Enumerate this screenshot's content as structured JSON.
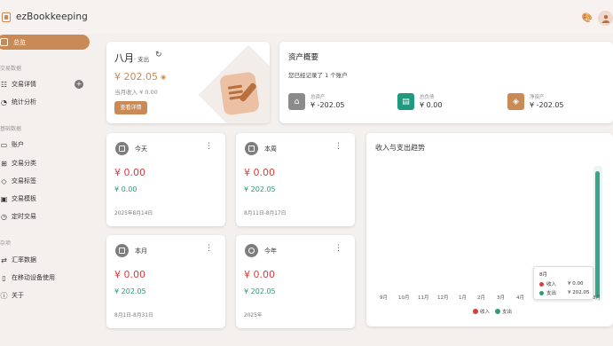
{
  "header": {
    "app_title": "ezBookkeeping"
  },
  "sidebar": {
    "overview_label": "总览",
    "section_transactions": "交易数据",
    "section_basic": "基础数据",
    "section_misc": "杂项",
    "items": [
      {
        "label": "交易详情",
        "icon": "list-icon"
      },
      {
        "label": "统计分析",
        "icon": "chart-icon"
      },
      {
        "label": "账户",
        "icon": "card-icon"
      },
      {
        "label": "交易分类",
        "icon": "category-icon"
      },
      {
        "label": "交易标签",
        "icon": "tag-icon"
      },
      {
        "label": "交易模板",
        "icon": "template-icon"
      },
      {
        "label": "定时交易",
        "icon": "clock-icon"
      },
      {
        "label": "汇率数据",
        "icon": "exchange-icon"
      },
      {
        "label": "在移动设备使用",
        "icon": "mobile-icon"
      },
      {
        "label": "关于",
        "icon": "info-icon"
      }
    ]
  },
  "month_card": {
    "title": "八月",
    "subtitle": "· 支出",
    "amount": "¥ 202.05",
    "income_line": "当月收入 ¥ 0.00",
    "button_label": "查看详情"
  },
  "asset_card": {
    "title": "资产概要",
    "count_text": "您已经记录了 1 个账户",
    "metrics": [
      {
        "label": "总资产",
        "value": "¥ -202.05",
        "color": "#8b8b8b"
      },
      {
        "label": "总负债",
        "value": "¥ 0.00",
        "color": "#1f9a7e"
      },
      {
        "label": "净资产",
        "value": "¥ -202.05",
        "color": "#c98a55"
      }
    ]
  },
  "summary_cards": [
    {
      "title": "今天",
      "expense": "¥ 0.00",
      "income": "¥ 0.00",
      "date": "2025年8月14日"
    },
    {
      "title": "本周",
      "expense": "¥ 0.00",
      "income": "¥ 202.05",
      "date": "8月11日-8月17日"
    },
    {
      "title": "本月",
      "expense": "¥ 0.00",
      "income": "¥ 202.05",
      "date": "8月1日-8月31日"
    },
    {
      "title": "今年",
      "expense": "¥ 0.00",
      "income": "¥ 202.05",
      "date": "2025年"
    }
  ],
  "trend": {
    "title": "收入与支出趋势",
    "months": [
      "9月",
      "10月",
      "11月",
      "12月",
      "1月",
      "2月",
      "3月",
      "4月",
      "8月"
    ],
    "legend": [
      {
        "name": "收入",
        "color": "#d23f3f"
      },
      {
        "name": "支出",
        "color": "#2f9a73"
      }
    ],
    "tooltip": {
      "month": "8月",
      "rows": [
        {
          "name": "收入",
          "value": "¥ 0.00",
          "color": "#d23f3f"
        },
        {
          "name": "支出",
          "value": "¥ 202.05",
          "color": "#2f9a73"
        }
      ]
    }
  }
}
